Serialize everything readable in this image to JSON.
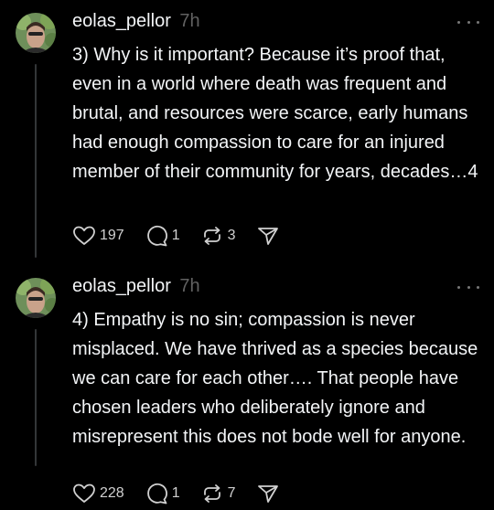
{
  "posts": [
    {
      "username": "eolas_pellor",
      "time": "7h",
      "text": "3) Why is it important? Because it’s proof that, even in a world where death was frequent and brutal, and resources were scarce, early humans had enough compassion to care for an injured member of their community for years, decades…4",
      "likes": "197",
      "replies": "1",
      "reposts": "3"
    },
    {
      "username": "eolas_pellor",
      "time": "7h",
      "text": "4) Empathy is no sin; compassion is never misplaced. We have thrived as a species because we can care for each other…. That people have chosen leaders who deliberately ignore and misrepresent this does not bode well for anyone.",
      "likes": "228",
      "replies": "1",
      "reposts": "7"
    }
  ],
  "icons": {
    "like": "heart-icon",
    "reply": "comment-icon",
    "repost": "repost-icon",
    "share": "send-icon",
    "more": "more-icon"
  },
  "colors": {
    "background": "#000000",
    "text": "#f3f5f7",
    "muted": "#616161",
    "icon": "#d0d0d0",
    "thread_line": "#333638"
  }
}
